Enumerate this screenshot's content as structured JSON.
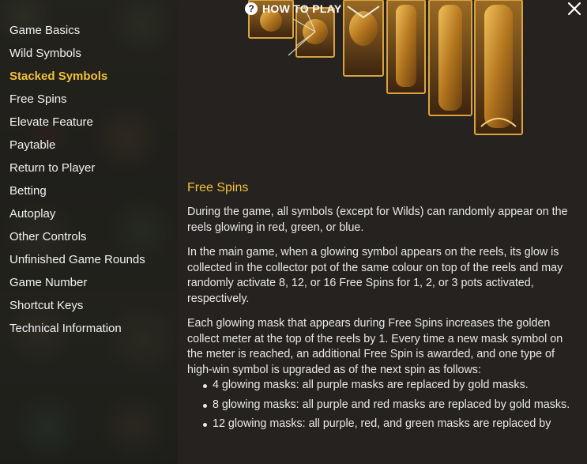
{
  "header": {
    "title": "HOW TO PLAY",
    "help_icon_glyph": "?",
    "close_icon": "close-icon"
  },
  "sidebar": {
    "items": [
      {
        "label": "Game Basics",
        "active": false
      },
      {
        "label": "Wild Symbols",
        "active": false
      },
      {
        "label": "Stacked Symbols",
        "active": true
      },
      {
        "label": "Free Spins",
        "active": false
      },
      {
        "label": "Elevate Feature",
        "active": false
      },
      {
        "label": "Paytable",
        "active": false
      },
      {
        "label": "Return to Player",
        "active": false
      },
      {
        "label": "Betting",
        "active": false
      },
      {
        "label": "Autoplay",
        "active": false
      },
      {
        "label": "Other Controls",
        "active": false
      },
      {
        "label": "Unfinished Game Rounds",
        "active": false
      },
      {
        "label": "Game Number",
        "active": false
      },
      {
        "label": "Shortcut Keys",
        "active": false
      },
      {
        "label": "Technical Information",
        "active": false
      }
    ]
  },
  "content": {
    "section_title": "Free Spins",
    "paragraphs": [
      "During the game, all symbols (except for Wilds) can randomly appear on the reels glowing in red, green, or blue.",
      "In the main game, when a glowing symbol appears on the reels, its glow is collected in the collector pot of the same colour on top of the reels and may randomly activate 8, 12, or 16 Free Spins for 1, 2, or 3 pots activated, respectively.",
      "Each glowing mask that appears during Free Spins increases the golden collect meter at the top of the reels by 1. Every time a new mask symbol on the meter is reached, an additional Free Spin is awarded, and one type of high-win symbol is upgraded as of the next spin as follows:"
    ],
    "bullets": [
      "4 glowing masks: all purple masks are replaced by gold masks.",
      "8 glowing masks: all purple and red masks are replaced by gold masks.",
      "12 glowing masks: all purple, red, and green masks are replaced by"
    ]
  },
  "colors": {
    "accent": "#f3c13a",
    "text": "#e9e9e9",
    "panel": "#25221f"
  }
}
